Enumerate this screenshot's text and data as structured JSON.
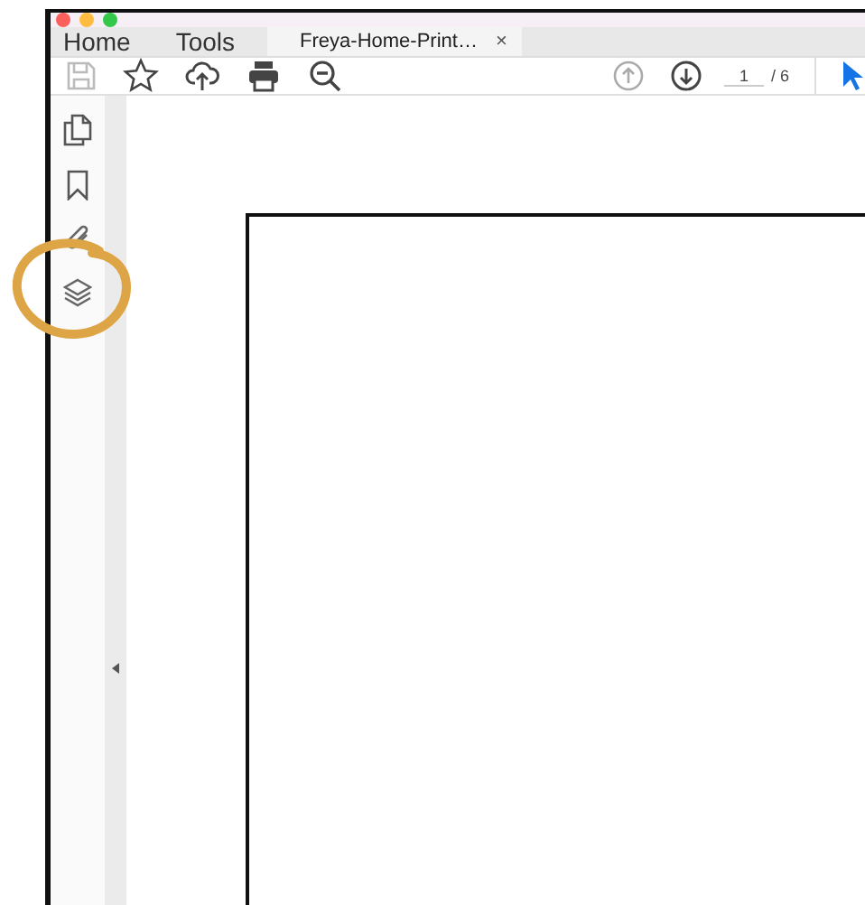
{
  "tabs": [
    {
      "label": "Home",
      "selected": false
    },
    {
      "label": "Tools",
      "selected": false
    },
    {
      "label": "Freya-Home-Print…",
      "selected": true,
      "close": "×"
    }
  ],
  "pager": {
    "current": "1",
    "total": "/ 6"
  },
  "sidebar": {
    "items": [
      {
        "kind": "pages",
        "highlighted": false
      },
      {
        "kind": "bookmark",
        "highlighted": false
      },
      {
        "kind": "attachment",
        "highlighted": false
      },
      {
        "kind": "layers",
        "highlighted": true
      }
    ]
  }
}
